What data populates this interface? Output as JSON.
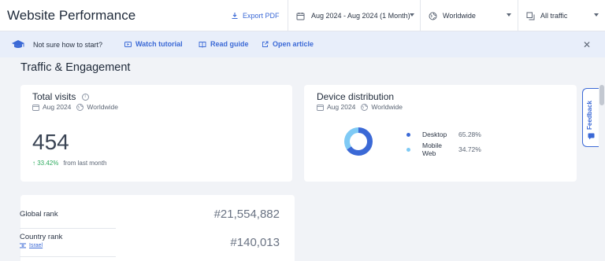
{
  "header": {
    "title": "Website Performance",
    "export_label": "Export PDF",
    "date_range": "Aug 2024 - Aug 2024 (1 Month)",
    "region": "Worldwide",
    "traffic_type": "All traffic"
  },
  "banner": {
    "question": "Not sure how to start?",
    "links": [
      "Watch tutorial",
      "Read guide",
      "Open article"
    ]
  },
  "section_title": "Traffic & Engagement",
  "total_visits": {
    "title": "Total visits",
    "period": "Aug 2024",
    "region": "Worldwide",
    "value": "454",
    "change": "33.42%",
    "change_suffix": "from last month"
  },
  "device_distribution": {
    "title": "Device distribution",
    "period": "Aug 2024",
    "region": "Worldwide",
    "segments": [
      {
        "label": "Desktop",
        "value": "65.28%",
        "fraction": 0.6528,
        "color": "#3b69d6"
      },
      {
        "label": "Mobile Web",
        "value": "34.72%",
        "fraction": 0.3472,
        "color": "#7fcaf5"
      }
    ]
  },
  "ranks": {
    "global_label": "Global rank",
    "global_value": "#21,554,882",
    "country_label": "Country rank",
    "country_value": "#140,013",
    "country_name": "Israel"
  },
  "feedback_label": "Feedback",
  "colors": {
    "accent": "#3b69d6",
    "positive": "#2faa5f",
    "banner_bg": "#e8eefa"
  }
}
